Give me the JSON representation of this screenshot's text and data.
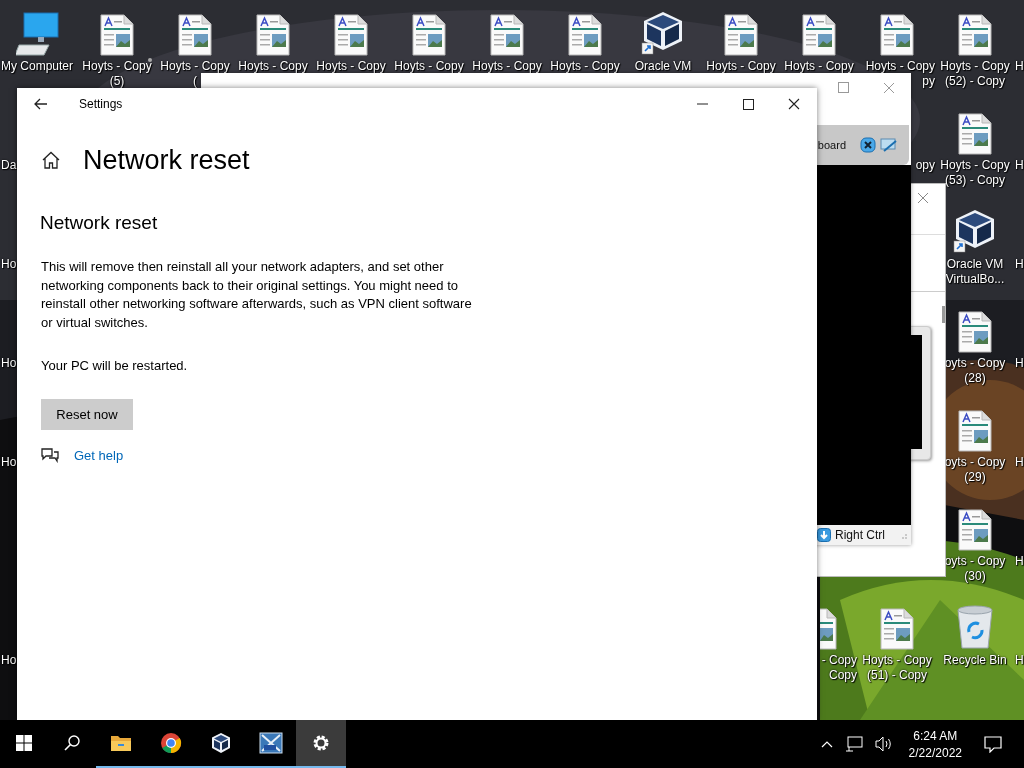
{
  "desktop": {
    "columns": [
      [
        {
          "kind": "computer",
          "label": [
            "My Computer"
          ]
        },
        {
          "kind": "none",
          "label": [
            "Da"
          ]
        },
        {
          "kind": "none",
          "label": [
            "Ho"
          ]
        },
        {
          "kind": "none",
          "label": [
            "Ho"
          ]
        },
        {
          "kind": "none",
          "label": [
            "Ho"
          ]
        },
        null,
        {
          "kind": "none",
          "label": [
            "Ho"
          ]
        }
      ],
      [
        {
          "kind": "document",
          "label": [
            "Hoyts - Copy",
            "(5)"
          ]
        }
      ],
      [
        {
          "kind": "document",
          "label": [
            "Hoyts - Copy",
            "("
          ]
        }
      ],
      [
        {
          "kind": "document",
          "label": [
            "Hoyts - Copy"
          ]
        }
      ],
      [
        {
          "kind": "document",
          "label": [
            "Hoyts - Copy"
          ]
        }
      ],
      [
        {
          "kind": "document",
          "label": [
            "Hoyts - Copy"
          ]
        }
      ],
      [
        {
          "kind": "document",
          "label": [
            "Hoyts - Copy"
          ]
        }
      ],
      [
        {
          "kind": "document",
          "label": [
            "Hoyts - Copy"
          ]
        }
      ],
      [
        {
          "kind": "virtualbox",
          "label": [
            "Oracle VM"
          ]
        }
      ],
      [
        {
          "kind": "document",
          "label": [
            "Hoyts - Copy"
          ]
        }
      ],
      [
        {
          "kind": "document",
          "label": [
            "Hoyts - Copy"
          ]
        },
        null,
        null,
        null,
        null,
        null,
        {
          "kind": "document-right-half",
          "label": [
            "- Copy",
            "Copy"
          ]
        }
      ],
      [
        {
          "kind": "document",
          "label": [
            "Hoyts - Copy",
            "py"
          ]
        },
        {
          "kind": "none",
          "label": [
            "opy"
          ]
        },
        null,
        null,
        null,
        null,
        {
          "kind": "document",
          "label": [
            "Hoyts - Copy",
            "(51) - Copy"
          ]
        }
      ],
      [
        {
          "kind": "document",
          "label": [
            "Hoyts - Copy",
            "(52) - Copy"
          ]
        },
        {
          "kind": "document",
          "label": [
            "Hoyts - Copy",
            "(53) - Copy"
          ]
        },
        {
          "kind": "virtualbox",
          "label": [
            "Oracle VM",
            "VirtualBo..."
          ]
        },
        {
          "kind": "document",
          "label": [
            "oyts - Copy",
            "(28)"
          ]
        },
        {
          "kind": "document",
          "label": [
            "oyts - Copy",
            "(29)"
          ]
        },
        {
          "kind": "document",
          "label": [
            "oyts - Copy",
            "(30)"
          ]
        },
        {
          "kind": "recycle-bin",
          "label": [
            "Recycle Bin"
          ]
        }
      ],
      [
        {
          "kind": "none",
          "label": [
            "H"
          ]
        },
        {
          "kind": "none",
          "label": [
            "H"
          ]
        },
        {
          "kind": "none",
          "label": [
            "H"
          ]
        },
        {
          "kind": "none",
          "label": [
            "H"
          ]
        },
        {
          "kind": "none",
          "label": [
            "H"
          ]
        },
        {
          "kind": "none",
          "label": [
            "H"
          ]
        },
        {
          "kind": "none",
          "label": [
            "H"
          ]
        }
      ]
    ]
  },
  "virtualbox_window": {
    "toolbar_text": "board",
    "status_text": "Right Ctrl"
  },
  "settings_window": {
    "title": "Settings",
    "heading": "Network reset",
    "section_title": "Network reset",
    "description": "This will remove then reinstall all your network adapters, and set other networking components back to their original settings. You might need to reinstall other networking software afterwards, such as VPN client software or virtual switches.",
    "note": "Your PC will be restarted.",
    "button": "Reset now",
    "help_link": "Get help"
  },
  "taskbar": {
    "apps": [
      {
        "kind": "start",
        "running": false,
        "selected": false
      },
      {
        "kind": "search",
        "running": false,
        "selected": false
      },
      {
        "kind": "file-explorer",
        "running": true,
        "selected": false
      },
      {
        "kind": "chrome",
        "running": true,
        "selected": false
      },
      {
        "kind": "virtualbox",
        "running": true,
        "selected": false
      },
      {
        "kind": "vista",
        "running": true,
        "selected": false
      },
      {
        "kind": "settings",
        "running": true,
        "selected": true
      }
    ],
    "time": "6:24 AM",
    "date": "2/22/2022"
  }
}
